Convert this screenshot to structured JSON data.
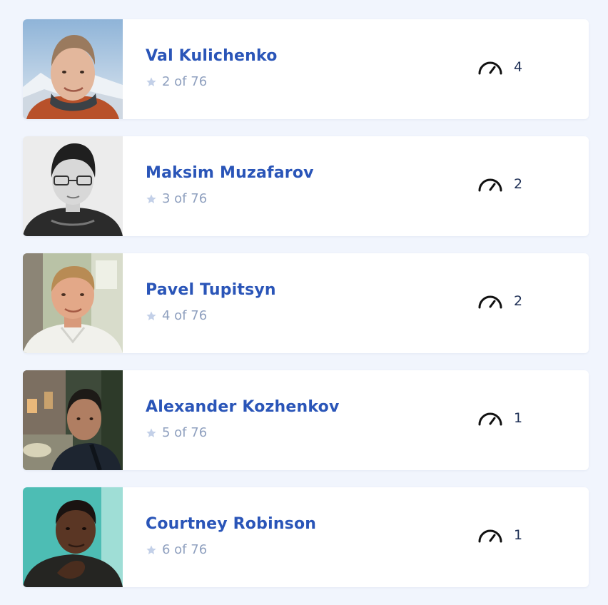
{
  "colors": {
    "page_background": "#f1f5fd",
    "card_background": "#ffffff",
    "name_link": "#2a55b8",
    "rank_text": "#8fa0bf",
    "star": "#c3d0e8",
    "metric_text": "#1e2f55"
  },
  "icons": {
    "rank": "star-icon",
    "metric": "speedometer-icon"
  },
  "people": [
    {
      "name": "Val Kulichenko",
      "rank": "2 of 76",
      "metric": "4"
    },
    {
      "name": "Maksim Muzafarov",
      "rank": "3 of 76",
      "metric": "2"
    },
    {
      "name": "Pavel Tupitsyn",
      "rank": "4 of 76",
      "metric": "2"
    },
    {
      "name": "Alexander Kozhenkov",
      "rank": "5 of 76",
      "metric": "1"
    },
    {
      "name": "Courtney Robinson",
      "rank": "6 of 76",
      "metric": "1"
    }
  ]
}
